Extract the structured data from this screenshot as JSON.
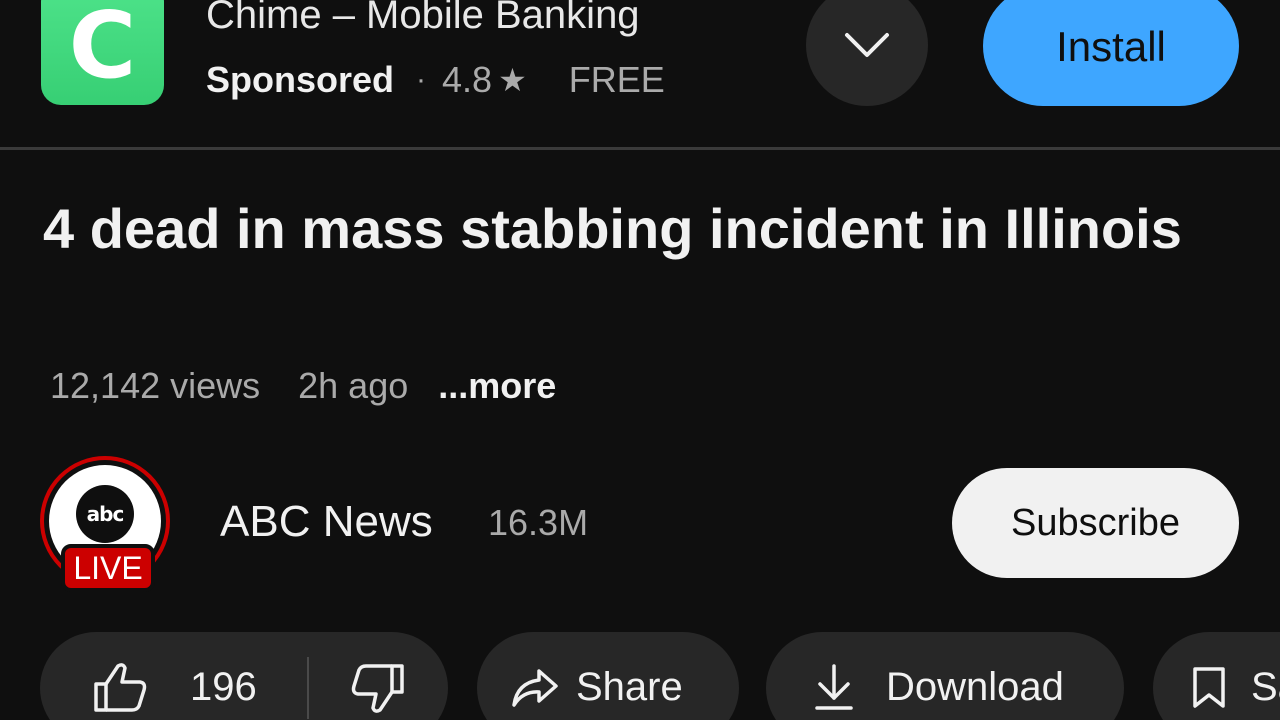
{
  "ad": {
    "app_icon_letter": "C",
    "title": "Chime – Mobile Banking",
    "sponsored": "Sponsored",
    "separator": "·",
    "rating": "4.8",
    "star": "★",
    "price": "FREE",
    "install_label": "Install",
    "icon_color": "#3fd67e",
    "install_color": "#3ea6ff"
  },
  "video": {
    "title": "4 dead in mass stabbing incident in Illinois",
    "views": "12,142 views",
    "age": "2h ago",
    "more": "...more"
  },
  "channel": {
    "logo_text": "abc",
    "live_badge": "LIVE",
    "name": "ABC News",
    "subscribers": "16.3M",
    "subscribe_label": "Subscribe"
  },
  "actions": {
    "like_count": "196",
    "share_label": "Share",
    "download_label": "Download",
    "save_label": "Save",
    "icons": [
      "thumb-up-icon",
      "thumb-down-icon",
      "share-icon",
      "download-icon",
      "bookmark-icon"
    ]
  }
}
